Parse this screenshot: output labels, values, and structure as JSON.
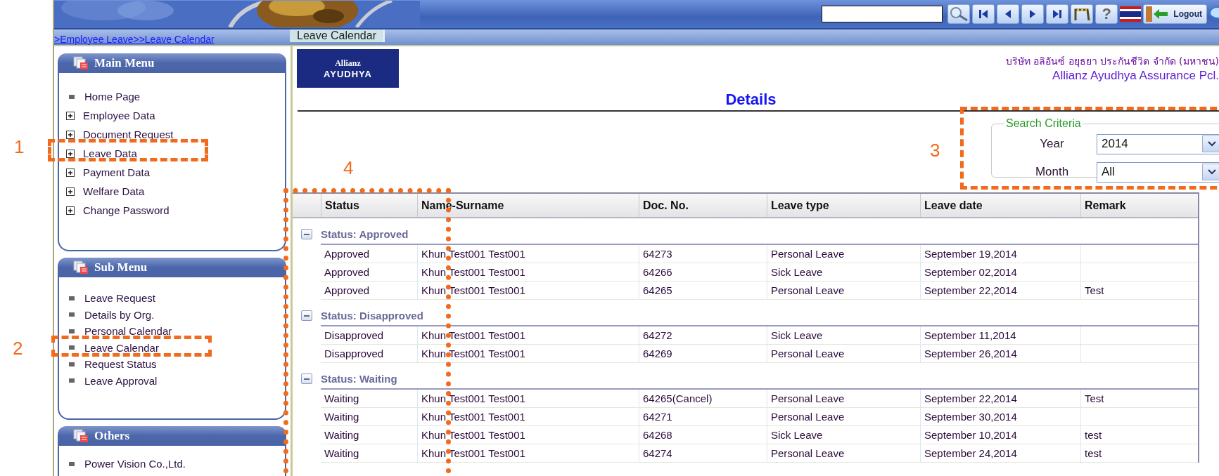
{
  "toolbar": {
    "help_label": "?",
    "logout_label": "Logout"
  },
  "breadcrumb": {
    "links": [
      ">Employee Leave",
      ">>Leave Calendar"
    ],
    "page_tab": "Leave Calendar"
  },
  "sidebar": [
    {
      "title": "Main Menu",
      "items": [
        {
          "label": "Home Page",
          "kind": "bullet"
        },
        {
          "label": "Employee Data",
          "kind": "expandable"
        },
        {
          "label": "Document Request",
          "kind": "expandable"
        },
        {
          "label": "Leave Data",
          "kind": "expandable"
        },
        {
          "label": "Payment Data",
          "kind": "expandable"
        },
        {
          "label": "Welfare Data",
          "kind": "expandable"
        },
        {
          "label": "Change Password",
          "kind": "expandable"
        }
      ]
    },
    {
      "title": "Sub Menu",
      "items": [
        {
          "label": "Leave Request",
          "kind": "bullet"
        },
        {
          "label": "Details by Org.",
          "kind": "bullet"
        },
        {
          "label": "Personal Calendar",
          "kind": "bullet"
        },
        {
          "label": "Leave Calendar",
          "kind": "bullet"
        },
        {
          "label": "Request Status",
          "kind": "bullet"
        },
        {
          "label": "Leave Approval",
          "kind": "bullet"
        }
      ]
    },
    {
      "title": "Others",
      "items": [
        {
          "label": "Power Vision Co.,Ltd.",
          "kind": "bullet"
        }
      ]
    }
  ],
  "company": {
    "logo_lines": [
      "Allianz",
      "AYUDHYA"
    ],
    "thai_name": "บริษัท อลิอันซ์ อยุธยา ประกันชีวิต จำกัด (มหาชน)",
    "english_name": "Allianz Ayudhya Assurance Pcl."
  },
  "title": "Details",
  "search_criteria": {
    "legend": "Search Criteria",
    "fields": [
      {
        "label": "Year",
        "value": "2014"
      },
      {
        "label": "Month",
        "value": "All"
      }
    ]
  },
  "table": {
    "columns": [
      "Status",
      "Name-Surname",
      "Doc. No.",
      "Leave type",
      "Leave date",
      "Remark"
    ],
    "groups": [
      {
        "title": "Status: Approved",
        "expanded": true,
        "rows": [
          [
            "Approved",
            "Khun Test001 Test001",
            "64273",
            "Personal Leave",
            "September 19,2014",
            ""
          ],
          [
            "Approved",
            "Khun Test001 Test001",
            "64266",
            "Sick Leave",
            "September 02,2014",
            ""
          ],
          [
            "Approved",
            "Khun Test001 Test001",
            "64265",
            "Personal Leave",
            "September 22,2014",
            "Test"
          ]
        ]
      },
      {
        "title": "Status: Disapproved",
        "expanded": true,
        "rows": [
          [
            "Disapproved",
            "Khun Test001 Test001",
            "64272",
            "Sick Leave",
            "September 11,2014",
            ""
          ],
          [
            "Disapproved",
            "Khun Test001 Test001",
            "64269",
            "Personal Leave",
            "September 26,2014",
            ""
          ]
        ]
      },
      {
        "title": "Status: Waiting",
        "expanded": true,
        "rows": [
          [
            "Waiting",
            "Khun Test001 Test001",
            "64265(Cancel)",
            "Personal Leave",
            "September 22,2014",
            "Test"
          ],
          [
            "Waiting",
            "Khun Test001 Test001",
            "64271",
            "Personal Leave",
            "September 30,2014",
            ""
          ],
          [
            "Waiting",
            "Khun Test001 Test001",
            "64268",
            "Sick Leave",
            "September 10,2014",
            "test"
          ],
          [
            "Waiting",
            "Khun Test001 Test001",
            "64274",
            "Personal Leave",
            "September 24,2014",
            "test"
          ]
        ]
      }
    ]
  },
  "annotations": [
    {
      "label": "1"
    },
    {
      "label": "2"
    },
    {
      "label": "3"
    },
    {
      "label": "4"
    }
  ]
}
